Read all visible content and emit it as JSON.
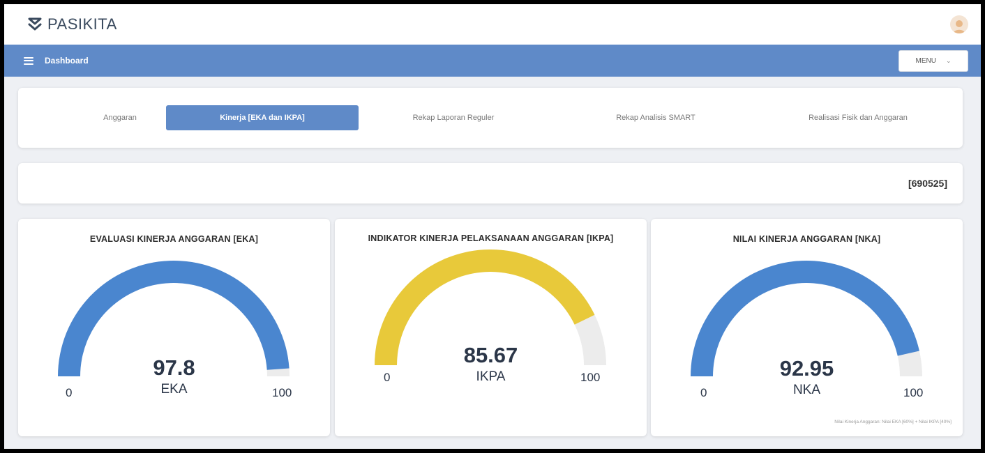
{
  "app": {
    "brand": "PASIKITA"
  },
  "nav": {
    "title": "Dashboard",
    "menu_label": "MENU",
    "menu_chevron": "⌄"
  },
  "tabs": [
    {
      "label": "Anggaran",
      "active": false
    },
    {
      "label": "Kinerja [EKA dan IKPA]",
      "active": true
    },
    {
      "label": "Rekap Laporan Reguler",
      "active": false
    },
    {
      "label": "Rekap Analisis SMART",
      "active": false
    },
    {
      "label": "Realisasi Fisik dan Anggaran",
      "active": false
    }
  ],
  "unit_code": "[690525]",
  "gauges": [
    {
      "title": "EVALUASI KINERJA ANGGARAN [EKA]",
      "value": "97.8",
      "label": "EKA",
      "min": "0",
      "max": "100",
      "color": "#4a86cf"
    },
    {
      "title": "INDIKATOR KINERJA PELAKSANAAN ANGGARAN [IKPA]",
      "value": "85.67",
      "label": "IKPA",
      "min": "0",
      "max": "100",
      "color": "#e8c93a"
    },
    {
      "title": "NILAI KINERJA ANGGARAN [NKA]",
      "value": "92.95",
      "label": "NKA",
      "min": "0",
      "max": "100",
      "color": "#4a86cf",
      "note": "Nilai Kinerja Anggaran: Nilai EKA [60%] + Nilai IKPA [40%]"
    }
  ],
  "colors": {
    "nav": "#5f8ac8",
    "track": "#ececec",
    "brand_icon": "#3a4a5e"
  },
  "chart_data": [
    {
      "type": "gauge",
      "title": "EVALUASI KINERJA ANGGARAN [EKA]",
      "value": 97.8,
      "range": [
        0,
        100
      ]
    },
    {
      "type": "gauge",
      "title": "INDIKATOR KINERJA PELAKSANAAN ANGGARAN [IKPA]",
      "value": 85.67,
      "range": [
        0,
        100
      ]
    },
    {
      "type": "gauge",
      "title": "NILAI KINERJA ANGGARAN [NKA]",
      "value": 92.95,
      "range": [
        0,
        100
      ]
    }
  ]
}
